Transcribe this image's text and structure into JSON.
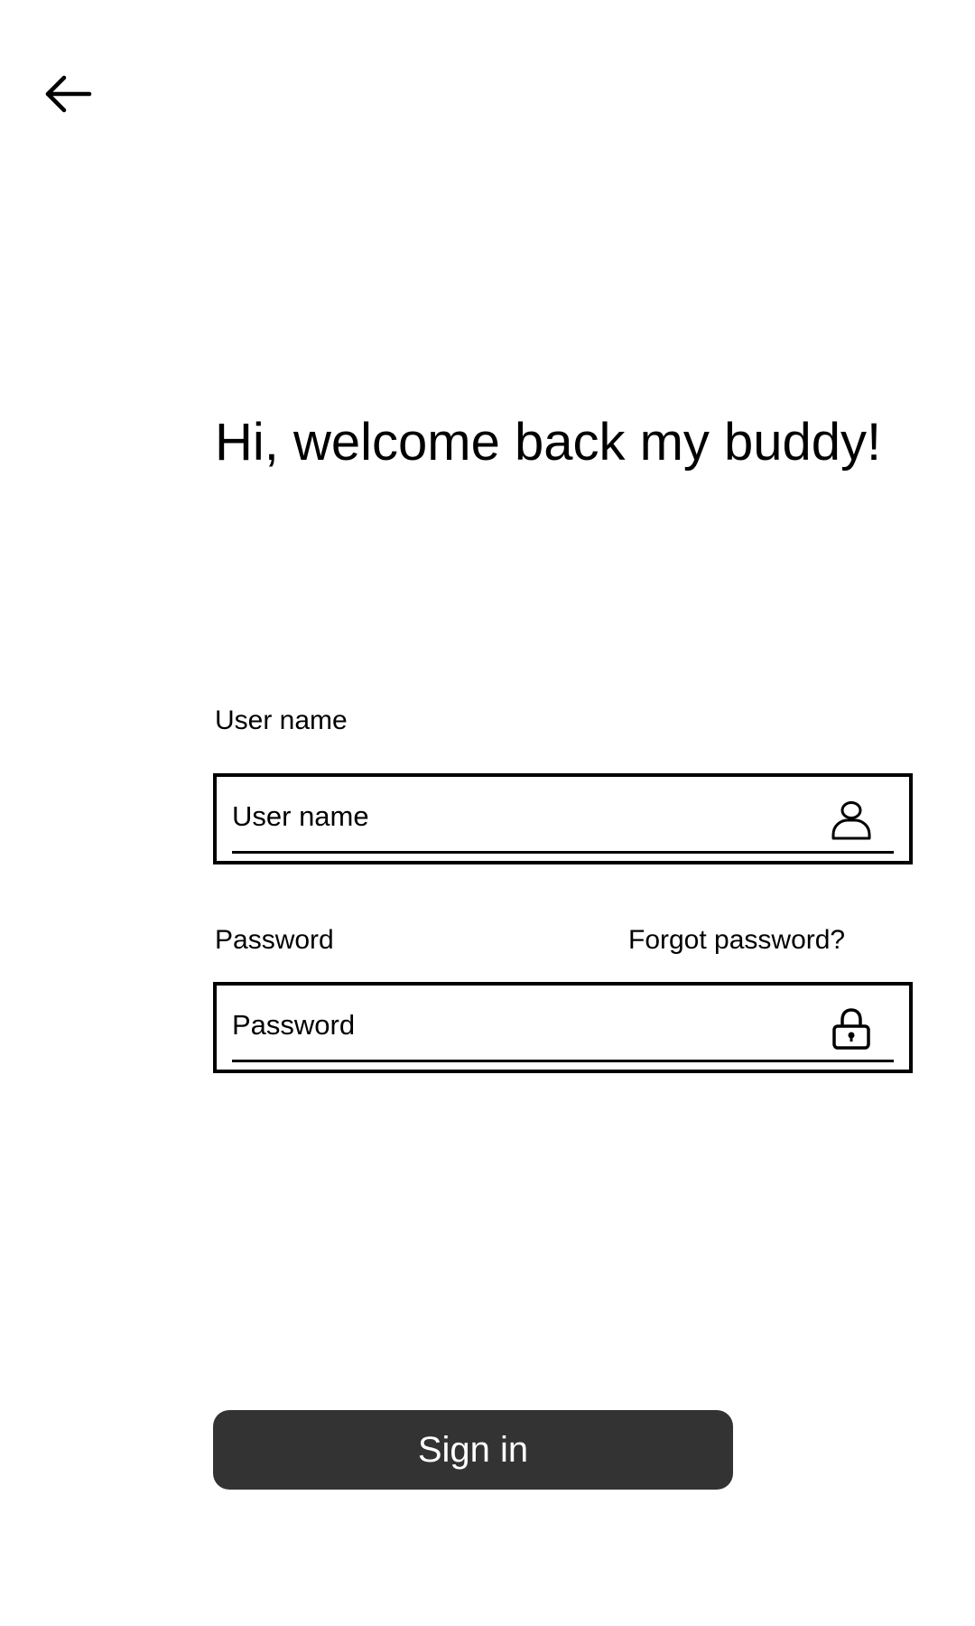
{
  "header": {
    "back_icon": "arrow-left-icon"
  },
  "greeting": {
    "title": "Hi, welcome back my buddy!"
  },
  "form": {
    "username": {
      "label": "User name",
      "placeholder": "User name",
      "value": "",
      "icon": "user-icon"
    },
    "password": {
      "label": "Password",
      "placeholder": "Password",
      "value": "",
      "icon": "lock-icon",
      "forgot_label": "Forgot password?"
    },
    "submit_label": "Sign in"
  },
  "colors": {
    "button_background": "#333333",
    "button_text": "#ffffff",
    "text": "#000000",
    "background": "#ffffff"
  }
}
